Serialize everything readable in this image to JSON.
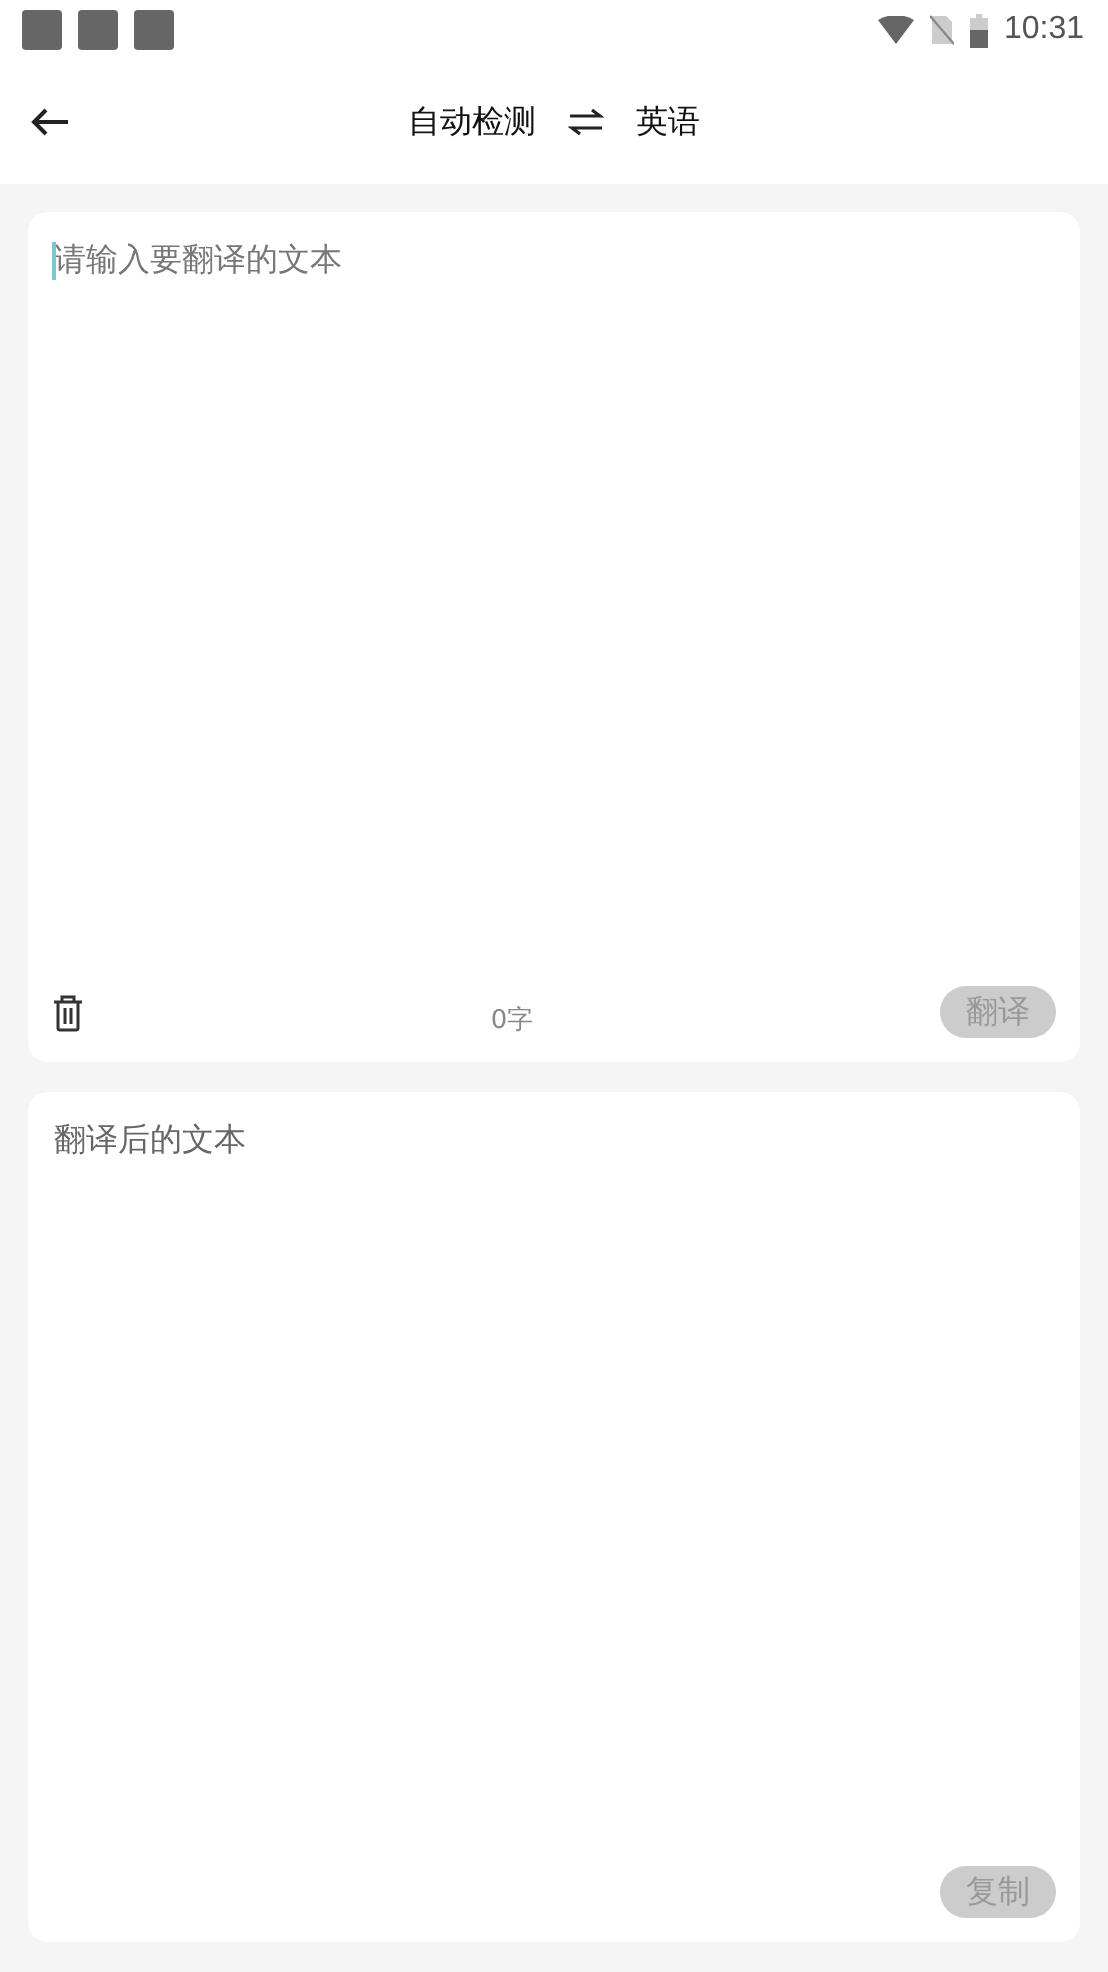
{
  "status_bar": {
    "time": "10:31"
  },
  "header": {
    "source_language": "自动检测",
    "target_language": "英语"
  },
  "input_card": {
    "placeholder": "请输入要翻译的文本",
    "char_count": "0字",
    "button": {
      "label": "翻译",
      "disabled": true
    }
  },
  "output_card": {
    "placeholder": "翻译后的文本",
    "button": {
      "label": "复制",
      "disabled": true
    }
  }
}
